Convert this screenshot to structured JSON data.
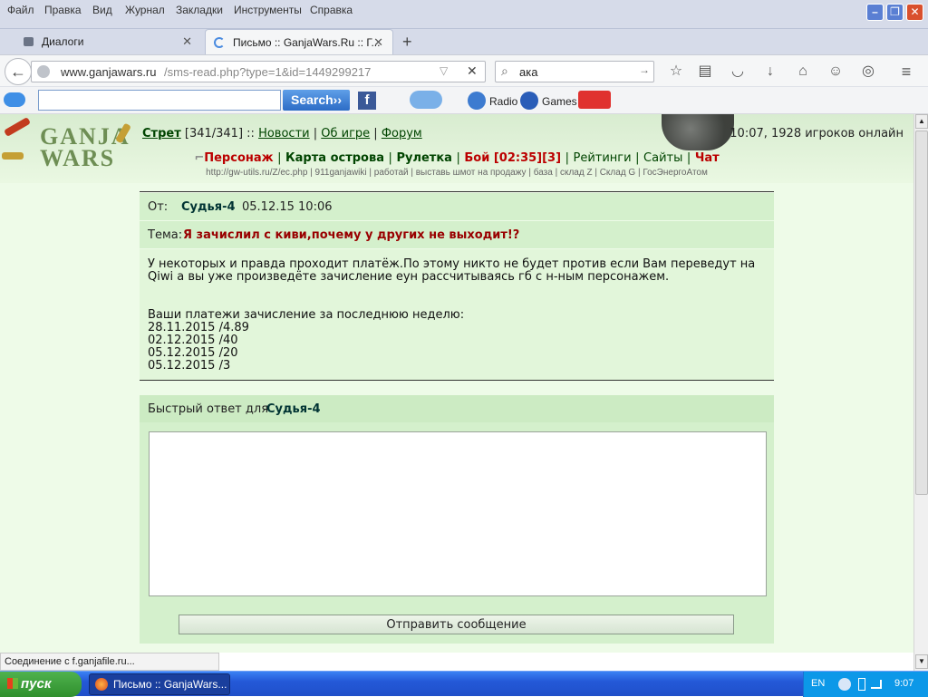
{
  "browser": {
    "menu": [
      "Файл",
      "Правка",
      "Вид",
      "Журнал",
      "Закладки",
      "Инструменты",
      "Справка"
    ],
    "tabs": [
      {
        "label": "Диалоги",
        "active": false
      },
      {
        "label": "Письмо :: GanjaWars.Ru :: Г...",
        "active": true
      }
    ],
    "url_host": "www.ganjawars.ru",
    "url_path": "/sms-read.php?type=1&id=1449299217",
    "search_value": "ака",
    "toolbar_search_button": "Search››",
    "radio": "Radio",
    "games": "Games",
    "status": "Соединение с f.ganjafile.ru..."
  },
  "site": {
    "logo_line1": "GANJA",
    "logo_line2": "WARS",
    "user": "Стрет",
    "hp": "[341/341]",
    "sep": "::",
    "news": "Новости",
    "about": "Об игре",
    "forum": "Форум",
    "time_online": "10:07, 1928 игроков онлайн",
    "nav": {
      "character": "Персонаж",
      "map": "Карта острова",
      "roulette": "Рулетка",
      "fight": "Бой [02:35][3]",
      "ratings": "Рейтинги",
      "sites": "Сайты",
      "chat": "Чат"
    },
    "quick_links": "http://gw-utils.ru/Z/ec.php | 911ganjawiki | работай | выставь шмот на продажу | база | склад Z | Склад G | ГосЭнергоАтом"
  },
  "message": {
    "from_label": "От:",
    "sender": "Судья-4",
    "date": "05.12.15 10:06",
    "subject_label": "Тема:",
    "subject": "Я зачислил с киви,почему у других не выходит!?",
    "body_1": "У некоторых и правда проходит платёж.По этому никто не будет против если Вам переведут на",
    "body_2": "Qiwi а вы уже произведёте зачисление еун рассчитываясь гб с н-ным персонажем.",
    "payments_title": "Ваши платежи зачисление за последнюю неделю:",
    "payments": [
      "28.11.2015 /4.89",
      "02.12.2015 /40",
      "05.12.2015 /20",
      "05.12.2015 /3"
    ]
  },
  "reply": {
    "label": "Быстрый ответ для",
    "to": "Судья-4",
    "text": "",
    "send_label": "Отправить сообщение"
  },
  "taskbar": {
    "start": "пуск",
    "item": "Письмо :: GanjaWars...",
    "lang": "EN",
    "clock": "9:07"
  }
}
